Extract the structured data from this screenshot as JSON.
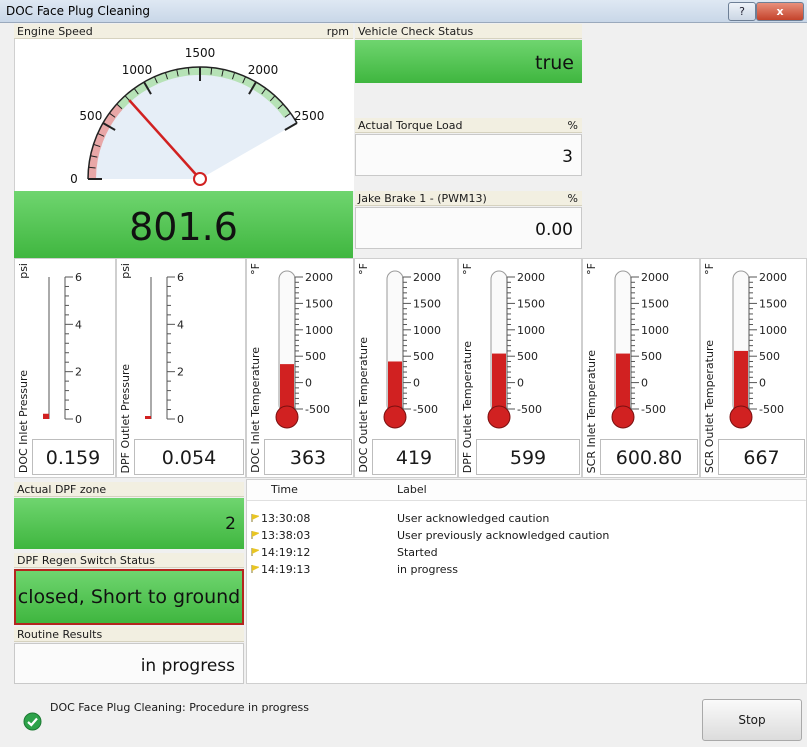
{
  "window": {
    "title": "DOC Face Plug Cleaning",
    "help_glyph": "?",
    "close_glyph": "x"
  },
  "engine_speed": {
    "label": "Engine Speed",
    "unit": "rpm",
    "value": "801.6",
    "scale_labels": [
      "0",
      "500",
      "1000",
      "1500",
      "2000",
      "2500"
    ],
    "needle_rpm": 801.6
  },
  "vehicle_check": {
    "label": "Vehicle Check Status",
    "value": "true"
  },
  "torque": {
    "label": "Actual Torque Load",
    "unit": "%",
    "value": "3"
  },
  "jake": {
    "label": "Jake Brake 1 - (PWM13)",
    "unit": "%",
    "value": "0.00"
  },
  "gauges": [
    {
      "label": "DOC Inlet Pressure",
      "unit": "psi",
      "value": "0.159",
      "ticks": [
        "6",
        "4",
        "2",
        "0"
      ],
      "fill": 0.03
    },
    {
      "label": "DPF Outlet Pressure",
      "unit": "psi",
      "value": "0.054",
      "ticks": [
        "6",
        "4",
        "2",
        "0"
      ],
      "fill": 0.0
    },
    {
      "label": "DOC Inlet Temperature",
      "unit": "°F",
      "value": "363",
      "ticks": [
        "2000",
        "1500",
        "1000",
        "500",
        "0",
        "-500"
      ],
      "fill": 0.34
    },
    {
      "label": "DOC Outlet Temperature",
      "unit": "°F",
      "value": "419",
      "ticks": [
        "2000",
        "1500",
        "1000",
        "500",
        "0",
        "-500"
      ],
      "fill": 0.36
    },
    {
      "label": "DPF Outlet Temperature",
      "unit": "°F",
      "value": "599",
      "ticks": [
        "2000",
        "1500",
        "1000",
        "500",
        "0",
        "-500"
      ],
      "fill": 0.42
    },
    {
      "label": "SCR Inlet Temperature",
      "unit": "°F",
      "value": "600.80",
      "ticks": [
        "2000",
        "1500",
        "1000",
        "500",
        "0",
        "-500"
      ],
      "fill": 0.42
    },
    {
      "label": "SCR Outlet Temperature",
      "unit": "°F",
      "value": "667",
      "ticks": [
        "2000",
        "1500",
        "1000",
        "500",
        "0",
        "-500"
      ],
      "fill": 0.44
    }
  ],
  "dpf_zone": {
    "label": "Actual DPF zone",
    "value": "2"
  },
  "regen_switch": {
    "label": "DPF Regen Switch Status",
    "value": "closed, Short to ground"
  },
  "routine": {
    "label": "Routine Results",
    "value": "in progress"
  },
  "log": {
    "col_time": "Time",
    "col_label": "Label",
    "rows": [
      {
        "time": "13:30:08",
        "label": "User acknowledged caution"
      },
      {
        "time": "13:38:03",
        "label": "User previously acknowledged caution"
      },
      {
        "time": "14:19:12",
        "label": "Started"
      },
      {
        "time": "14:19:13",
        "label": "in progress"
      }
    ]
  },
  "status": {
    "text": "DOC Face Plug Cleaning: Procedure in progress"
  },
  "stop_label": "Stop",
  "colors": {
    "green": "#4cc24c",
    "red": "#d12121",
    "accent_border": "#b3261e"
  }
}
